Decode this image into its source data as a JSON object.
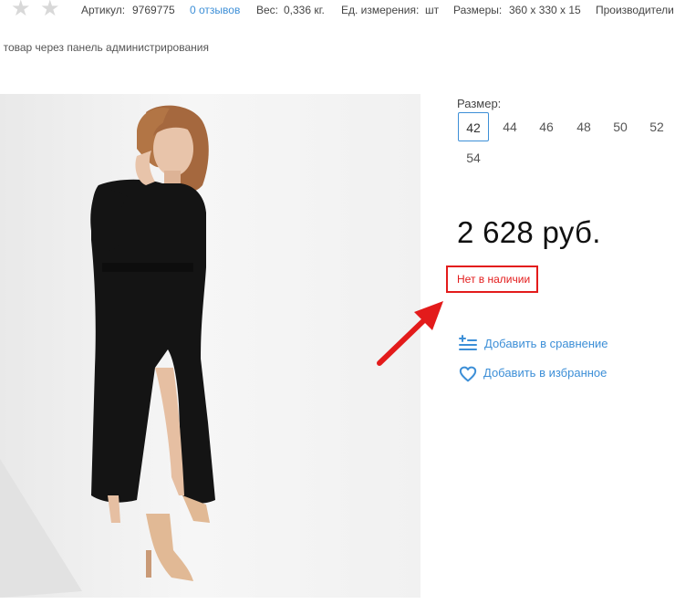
{
  "header": {
    "article_label": "Артикул:",
    "article_value": "9769775",
    "reviews_link": "0 отзывов",
    "weight_label": "Вес:",
    "weight_value": "0,336 кг.",
    "unit_label": "Ед. измерения:",
    "unit_value": "шт",
    "dimensions_label": "Размеры:",
    "dimensions_value": "360 x 330 x 15",
    "manufacturer_label": "Производители"
  },
  "admin_note": "ь товар через панель администрирования",
  "size": {
    "label": "Размер:",
    "options": [
      "42",
      "44",
      "46",
      "48",
      "50",
      "52",
      "54"
    ],
    "selected": "42"
  },
  "price": "2 628 руб.",
  "stock_status": "Нет в наличии",
  "actions": {
    "compare": "Добавить в сравнение",
    "favorite": "Добавить в избранное"
  },
  "colors": {
    "accent": "#3d8fd7",
    "warning": "#e31b1b"
  }
}
